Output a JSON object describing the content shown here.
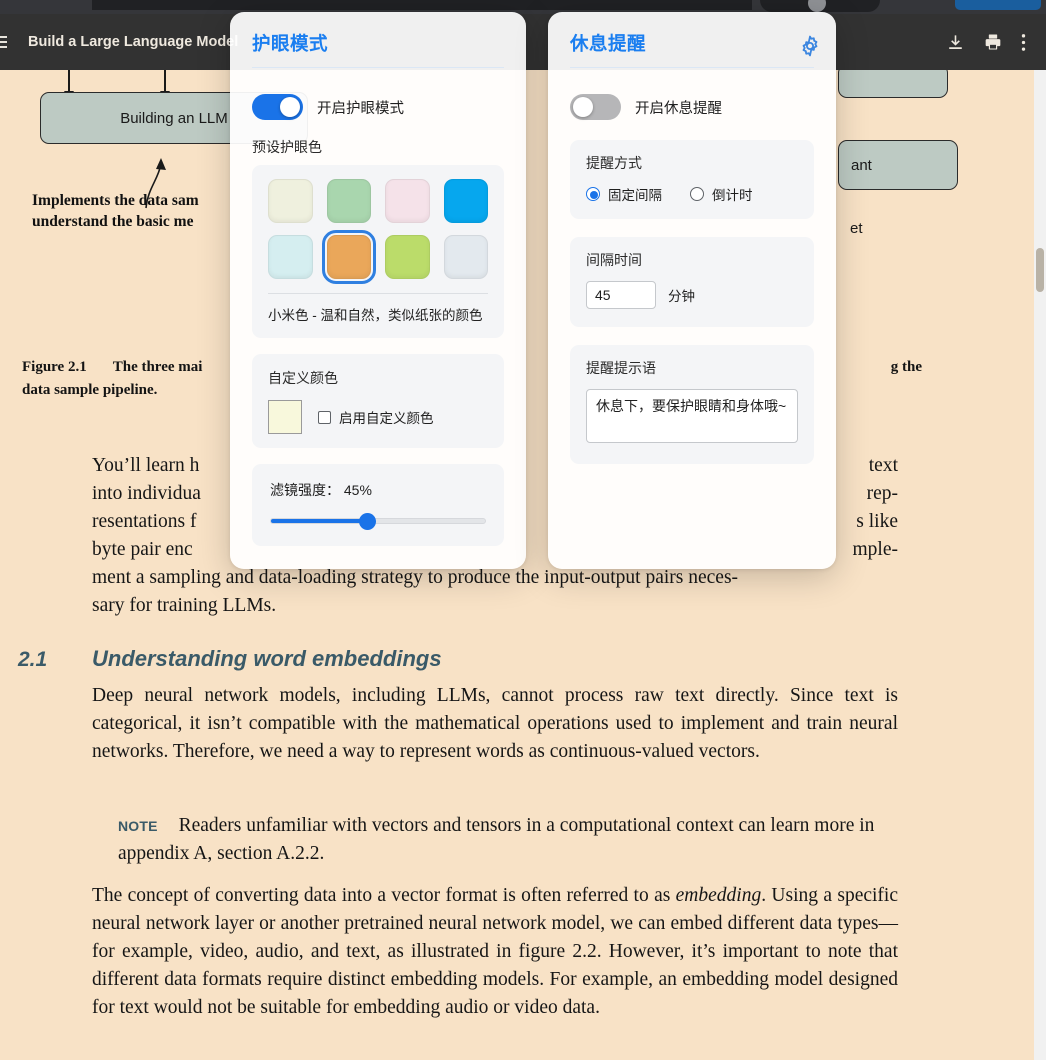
{
  "browser": {
    "tab_placeholder": "",
    "action_button_label": ""
  },
  "pdf_viewer": {
    "menu_icon": "hamburger-menu-icon",
    "title": "Build a Large Language Model",
    "tools": [
      {
        "name": "download-icon",
        "label": "Download"
      },
      {
        "name": "print-icon",
        "label": "Print"
      },
      {
        "name": "more-options-icon",
        "label": "More"
      }
    ]
  },
  "document": {
    "figure": {
      "box_label": "Building an LLM",
      "box_label_right": "ant",
      "callout_line1": "Implements the data sam",
      "callout_line2": "understand the basic me",
      "stray_text": "et",
      "caption_lead": "Figure 2.1",
      "caption_part1": "The three mai",
      "caption_part2": "g the",
      "caption_part3": "data sample pipeline."
    },
    "paragraphs": {
      "p1_pre": "You’ll learn h",
      "p1_right1": "text",
      "p1_left2": "into individua",
      "p1_right2": "rep-",
      "p1_left3": "resentations f",
      "p1_right3": "s like",
      "p1_left4": "byte pair enc",
      "p1_right4": "mple-",
      "p1_line5": "ment a sampling and data-loading strategy to produce the input-output pairs neces-",
      "p1_line6": "sary for training LLMs.",
      "section_number": "2.1",
      "section_title": "Understanding word embeddings",
      "p2": "Deep neural network models, including LLMs, cannot process raw text directly. Since text is categorical, it isn’t compatible with the mathematical operations used to implement and train neural networks. Therefore, we need a way to represent words as continuous-valued vectors.",
      "note_label": "NOTE",
      "note_text": "Readers unfamiliar with vectors and tensors in a computational context can learn more in appendix A, section A.2.2.",
      "p3_a": "The concept of converting data into a vector format is often referred to as ",
      "p3_em": "embedding",
      "p3_b": ". Using a specific neural network layer or another pretrained neural network model, we can embed different data types—for example, video, audio, and text, as illustrated in figure 2.2. However, it’s important to note that different data formats require distinct embedding models. For example, an embedding model designed for text would not be suitable for embedding audio or video data."
    }
  },
  "eyecare_panel": {
    "title": "护眼模式",
    "enable_toggle_label": "开启护眼模式",
    "enable_toggle_on": true,
    "preset_label": "预设护眼色",
    "presets": [
      {
        "name": "swatch-ivory",
        "color": "#eff0de"
      },
      {
        "name": "swatch-green",
        "color": "#a9d6ae"
      },
      {
        "name": "swatch-pink",
        "color": "#f5e2e9"
      },
      {
        "name": "swatch-sky-blue",
        "color": "#06a7ee"
      },
      {
        "name": "swatch-pale-cyan",
        "color": "#d5eef0"
      },
      {
        "name": "swatch-millet",
        "color": "#eaa75a"
      },
      {
        "name": "swatch-lime",
        "color": "#bbdc6a"
      },
      {
        "name": "swatch-silver",
        "color": "#e3e9ee"
      }
    ],
    "selected_index": 5,
    "selected_description": "小米色 - 温和自然，类似纸张的颜色",
    "custom_title": "自定义颜色",
    "custom_color": "#f8f8dc",
    "custom_checkbox_label": "启用自定义颜色",
    "custom_checkbox_checked": false,
    "filter_label": "滤镜强度：  45%",
    "filter_value": 45,
    "accent_color": "#1a73e8"
  },
  "rest_panel": {
    "title": "休息提醒",
    "gear_icon": "gear-icon",
    "enable_toggle_label": "开启休息提醒",
    "enable_toggle_on": false,
    "mode_title": "提醒方式",
    "mode_options": [
      {
        "label": "固定间隔",
        "checked": true
      },
      {
        "label": "倒计时",
        "checked": false
      }
    ],
    "interval_title": "间隔时间",
    "interval_value": "45",
    "interval_unit": "分钟",
    "message_title": "提醒提示语",
    "message_value": "休息下，要保护眼睛和身体哦~"
  }
}
